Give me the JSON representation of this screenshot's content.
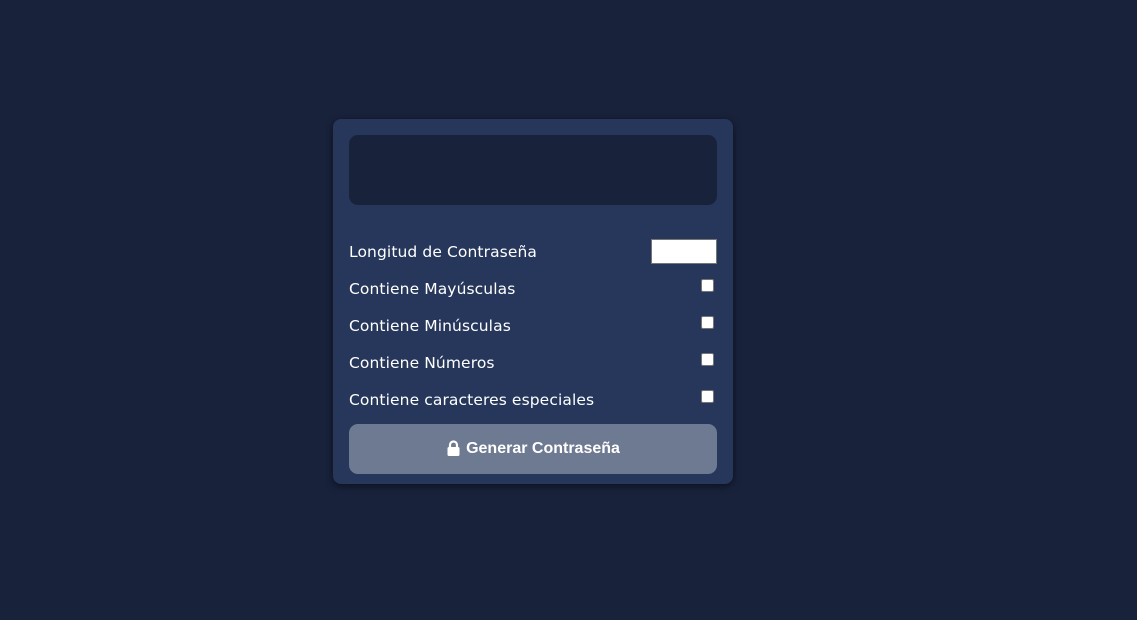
{
  "generator": {
    "result_value": "",
    "settings": [
      {
        "label": "Longitud de Contraseña",
        "control": "number",
        "value": ""
      },
      {
        "label": "Contiene Mayúsculas",
        "control": "checkbox",
        "checked": false
      },
      {
        "label": "Contiene Minúsculas",
        "control": "checkbox",
        "checked": false
      },
      {
        "label": "Contiene Números",
        "control": "checkbox",
        "checked": false
      },
      {
        "label": "Contiene caracteres especiales",
        "control": "checkbox",
        "checked": false
      }
    ],
    "generate_button": {
      "label": "Generar Contraseña",
      "icon": "lock-icon"
    }
  },
  "colors": {
    "page_background": "#18223b",
    "card_background": "#26375b",
    "result_background": "#19223b",
    "button_background": "#6e7a91",
    "text": "#ffffff"
  }
}
